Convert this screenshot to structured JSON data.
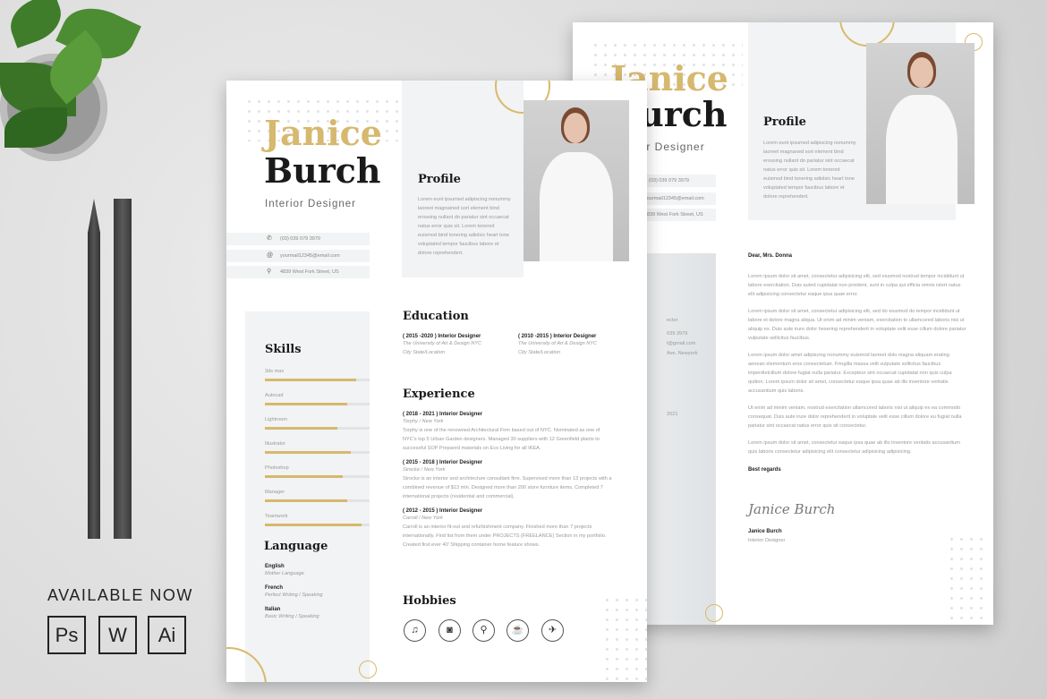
{
  "promo": {
    "available": "AVAILABLE NOW",
    "formats": [
      "Ps",
      "W",
      "Ai"
    ]
  },
  "resume": {
    "first_name": "Janice",
    "last_name": "Burch",
    "title": "Interior Designer",
    "contacts": [
      {
        "icon": "phone-icon",
        "text": "(03) 039 079 3979"
      },
      {
        "icon": "at-icon",
        "text": "yourmail12345@email.com"
      },
      {
        "icon": "location-pin-icon",
        "text": "4839 West Fork Street, US"
      }
    ],
    "profile_heading": "Profile",
    "profile_text": "Lorem eunt ipsumed adipiscing nonummy laoreet magnained sort element bind erossing nullant do pariatur sint occaecat natus error quis sit. Lorem tonered euismod bind tonering adiolsic heart tone voluptated tempor faucibus labore et dolore reprehendert.",
    "skills_heading": "Skills",
    "skills": [
      {
        "name": "3ds max",
        "level": 0.87
      },
      {
        "name": "Autocad",
        "level": 0.79
      },
      {
        "name": "Lightroom",
        "level": 0.69
      },
      {
        "name": "Illustrator",
        "level": 0.82
      },
      {
        "name": "Photoshop",
        "level": 0.74
      },
      {
        "name": "Manager",
        "level": 0.79
      },
      {
        "name": "Teamwork",
        "level": 0.92
      }
    ],
    "language_heading": "Language",
    "languages": [
      {
        "name": "English",
        "level": "Mother Language"
      },
      {
        "name": "French",
        "level": "Perfect Writing / Speaking"
      },
      {
        "name": "Italian",
        "level": "Basic Writing / Speaking"
      }
    ],
    "education_heading": "Education",
    "education": [
      {
        "title": "( 2015 -2020 ) Interior Designer",
        "school": "The University of Art & Design NYC",
        "location": "City State/Location"
      },
      {
        "title": "( 2010 -2015 ) Interior Designer",
        "school": "The University of Art & Design NYC",
        "location": "City State/Location"
      }
    ],
    "experience_heading": "Experience",
    "experience": [
      {
        "title": "( 2018 - 2021 ) Interior Designer",
        "company": "Torphy / New York",
        "desc": "Torphy is one of the renowned Architectural Firm based out of NYC. Nominated as one of NYC's top 5 Urban Garden designers. Managed 30 suppliers with 12 Greenfield plants to successful SOP Prepared materials on Eco Living for all IKEA."
      },
      {
        "title": "( 2015 - 2018 ) Interior Designer",
        "company": "Strocke / New York",
        "desc": "Strocke is an interior and architecture consultant firm. Supervised more than 13 projects with a combined revenue of $13 mln. Designed more than 200 store furniture items. Completed 7 international projects (residential and commercial)."
      },
      {
        "title": "( 2012 - 2015 ) Interior Designer",
        "company": "Carroll / New York",
        "desc": "Carroll is an interior fit-out and refurbishment company. Finished more than 7 projects internationally. Find list from them under PROJECTS (FREELANCE) Section in my portfolio. Created first ever 40' Shipping container home feature shows."
      }
    ],
    "hobbies_heading": "Hobbies",
    "hobbies": [
      "music-icon",
      "camera-icon",
      "cycling-icon",
      "coffee-icon",
      "airplane-icon"
    ]
  },
  "letter": {
    "first_name": "Janice",
    "last_name": "Burch",
    "title": "Interior Designer",
    "contacts": [
      "(03) 039 079 3979",
      "yourmail12345@email.com",
      "4839 West Fork Street, US"
    ],
    "side": {
      "role": "ector",
      "phone": "039 3979",
      "email": "l@gmail.com",
      "address": "Ave, Newyork",
      "year": "2021"
    },
    "profile_heading": "Profile",
    "profile_text": "Lorem eunt ipsumed adipiscing nonummy laoreet magnaned sort element bind erossing nullant do pariatur sint occaecat natus error quis sit. Lorem tonered euismod bind tonering adiolsic heart tone voluptated tempor faucibus labore et dolore reprehendert.",
    "greeting": "Dear, Mrs. Donna",
    "paragraphs": [
      "Lorem ipsum dolor sit amet, consectetur adipisicing elit, sed eiusmod nostrud tempor incididunt ut labore exercitation. Duis auted cupidatat non proident, sunt in culpa qui efficia omnis istert natus elit adipisicing consectetur eaque ipsa quae error.",
      "Lorem ipsum dolor sit amet, consectetur adipisicing elit, sed do eiusmod do tempor incididunt ut labore et dolore magna aliqua. Ut enim ad minim veniam, exercitation to ullamcored laboris nisi ut aliquip ex. Duis aute irure dolor hesering reprehenderit in voluptate velit esse cillum dolore pariatur vulputate sellicitus faucibus.",
      "Lorem ipsum dolor amet adipiscing nonummy euismod laoreet dolo magna aliquam erating aenean elementum eros consectetuer. Fringilla massa velit vulputate sollicitus faucibus imperdietcillum dolore fugiat nulla pariatur. Excepteur sint occaecat cupidatat non quis culpa quition. Lorem ipsum dolor sit amet, consectetur eaque ipsa quae ab illo inventore veritatis accusantium quis laboris.",
      "Ut enim ad minim veniam, nostrud exercitation ullamcored laboris nisi ut aliquip ex ea commodo consequat. Duis aute irure dolor reprehenderit in voluptate velit esse cillum dolore eu fugiat nulla pariatur sint occaecat natus error quis sit consectetur.",
      "Lorem ipsum dolor sit amet, consectetur eaque ipsa quae ab illo inventore veritatis accusantium quis laboris consectetur adipisicing elit consectetur adipisicing adipisicing."
    ],
    "closing": "Best regards",
    "signature": "Janice Burch",
    "sign_name": "Janice Burch",
    "sign_title": "Interior Designer"
  },
  "colors": {
    "accent": "#d6b86e",
    "panel": "#f1f3f4",
    "text": "#1a1a1a"
  }
}
